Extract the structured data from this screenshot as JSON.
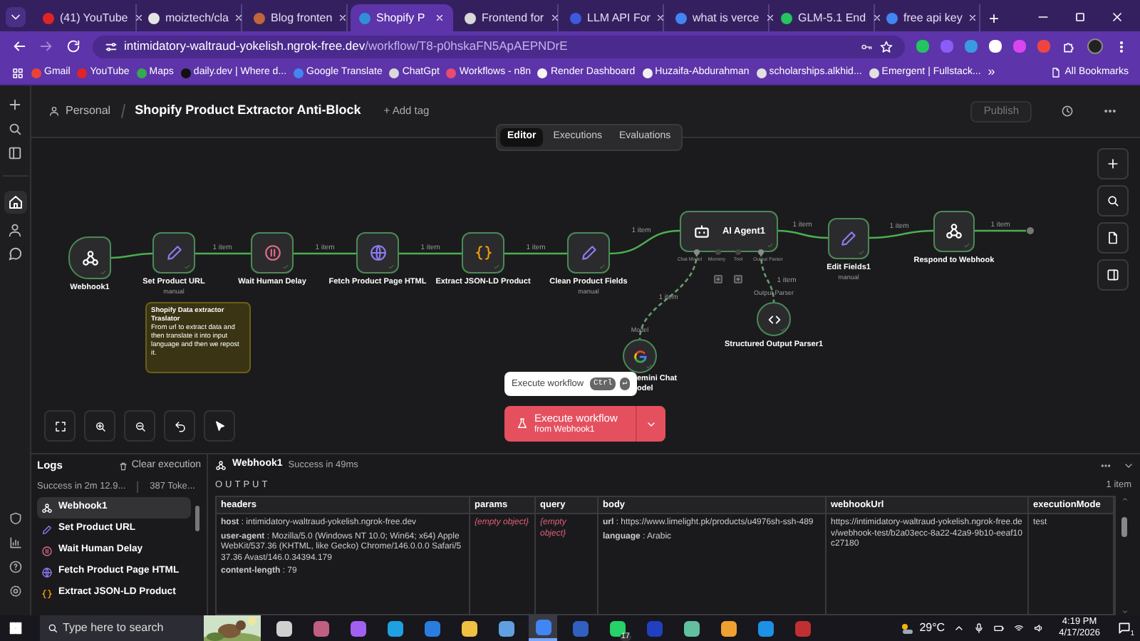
{
  "browser": {
    "tabs": [
      {
        "title": "(41) YouTube",
        "selected": false,
        "color": "#e02424"
      },
      {
        "title": "moiztech/cla",
        "selected": false,
        "color": "#e5e5e5"
      },
      {
        "title": "Blog fronten",
        "selected": false,
        "color": "#c0663a"
      },
      {
        "title": "Shopify P",
        "selected": true,
        "color": "#2f8fd8"
      },
      {
        "title": "Frontend for",
        "selected": false,
        "color": "#d9d9d9"
      },
      {
        "title": "LLM API For",
        "selected": false,
        "color": "#3b5bdb"
      },
      {
        "title": "what is verce",
        "selected": false,
        "color": "#4285f4"
      },
      {
        "title": "GLM-5.1 End",
        "selected": false,
        "color": "#22c55e"
      },
      {
        "title": "free api key",
        "selected": false,
        "color": "#4285f4"
      }
    ],
    "new_tab": "+",
    "url": {
      "host": "intimidatory-waltraud-yokelish.ngrok-free.dev",
      "path": "/workflow/T8-p0hskaFN5ApAEPNDrE"
    },
    "bookmarks": [
      {
        "label": "Gmail",
        "color": "#ea4335"
      },
      {
        "label": "YouTube",
        "color": "#e02424"
      },
      {
        "label": "Maps",
        "color": "#34a853"
      },
      {
        "label": "daily.dev | Where d...",
        "color": "#111111"
      },
      {
        "label": "Google Translate",
        "color": "#4285f4"
      },
      {
        "label": "ChatGpt",
        "color": "#d9d9d9"
      },
      {
        "label": "Workflows - n8n",
        "color": "#ea4b71"
      },
      {
        "label": "Render Dashboard",
        "color": "#f5f5f5"
      },
      {
        "label": "Huzaifa-Abdurahman",
        "color": "#f0f0f0"
      },
      {
        "label": "scholarships.alkhid...",
        "color": "#e0e0e0"
      },
      {
        "label": "Emergent | Fullstack...",
        "color": "#e0e0e0"
      }
    ],
    "more": "»",
    "all_bookmarks": "All Bookmarks"
  },
  "header": {
    "project": "Personal",
    "title": "Shopify Product Extractor Anti-Block",
    "add_tag": "+ Add tag",
    "publish": "Publish"
  },
  "view_tabs": [
    {
      "label": "Editor",
      "selected": true
    },
    {
      "label": "Executions",
      "selected": false
    },
    {
      "label": "Evaluations",
      "selected": false
    }
  ],
  "nodes": [
    {
      "kind": "webhook",
      "label": "Webhook1",
      "success": true
    },
    {
      "kind": "set",
      "label": "Set Product URL",
      "note": "manual",
      "success": true
    },
    {
      "kind": "wait",
      "label": "Wait Human Delay",
      "success": true
    },
    {
      "kind": "http",
      "label": "Fetch Product Page HTML",
      "success": true
    },
    {
      "kind": "code",
      "label": "Extract JSON-LD Product",
      "success": true
    },
    {
      "kind": "set",
      "label": "Clean Product Fields",
      "note": "manual",
      "success": true
    },
    {
      "kind": "agent",
      "label": "AI Agent1",
      "success": true,
      "ports": [
        {
          "label": "Chat Model",
          "connected": true
        },
        {
          "label": "Memory",
          "connected": false
        },
        {
          "label": "Tool",
          "connected": false
        },
        {
          "label": "Output Parser",
          "connected": true
        }
      ]
    },
    {
      "kind": "set",
      "label": "Edit Fields1",
      "note": "manual",
      "success": true
    },
    {
      "kind": "respond",
      "label": "Respond to Webhook",
      "success": true
    },
    {
      "kind": "model",
      "label": "emini Chat\nodel",
      "port_label": "Model",
      "success": true
    },
    {
      "kind": "parser",
      "label": "Structured Output Parser1",
      "port_label": "Output Parser",
      "success": true
    }
  ],
  "connections": [
    {
      "label": "1 item"
    },
    {
      "label": "1 item"
    },
    {
      "label": "1 item"
    },
    {
      "label": "1 item"
    },
    {
      "label": "1 item"
    },
    {
      "label": "1 item"
    },
    {
      "label": "1 item"
    },
    {
      "label": "1 item"
    },
    {
      "label": "1 item"
    },
    {
      "label": "1 item"
    }
  ],
  "sticky_note": {
    "title": "Shopify Data extractor\nTraslator",
    "body": "From url to extract data and then translate it into input language and then we repost it."
  },
  "execute": {
    "tooltip": "Execute workflow",
    "keys": [
      "Ctrl",
      "↵"
    ],
    "label": "Execute workflow",
    "sublabel": "from Webhook1"
  },
  "logs": {
    "title": "Logs",
    "clear": "Clear execution",
    "summary": "Success in 2m 12.9...",
    "tokens": "387 Toke...",
    "items": [
      {
        "kind": "webhook",
        "label": "Webhook1",
        "selected": true
      },
      {
        "kind": "set",
        "label": "Set Product URL",
        "selected": false
      },
      {
        "kind": "wait",
        "label": "Wait Human Delay",
        "selected": false
      },
      {
        "kind": "http",
        "label": "Fetch Product Page HTML",
        "selected": false
      },
      {
        "kind": "code",
        "label": "Extract JSON-LD Product",
        "selected": false
      }
    ]
  },
  "output": {
    "node": "Webhook1",
    "status": "Success in 49ms",
    "heading": "OUTPUT",
    "count": "1 item",
    "columns": [
      "headers",
      "params",
      "query",
      "body",
      "webhookUrl",
      "executionMode"
    ],
    "cells": [
      {
        "kind": "object",
        "entries": [
          "**host** : intimidatory-waltraud-yokelish.ngrok-free.dev",
          "**user-agent** : Mozilla/5.0 (Windows NT 10.0; Win64; x64) AppleWebKit/537.36 (KHTML, like Gecko) Chrome/146.0.0.0 Safari/537.36 Avast/146.0.34394.179",
          "**content-length** : 79"
        ]
      },
      {
        "kind": "empty",
        "text": "{empty object}"
      },
      {
        "kind": "empty",
        "text": "{empty object}"
      },
      {
        "kind": "object",
        "entries": [
          "**url** : https://www.limelight.pk/products/u4976sh-ssh-489",
          "**language** : Arabic"
        ]
      },
      {
        "kind": "text",
        "text": "https://intimidatory-waltraud-yokelish.ngrok-free.dev/webhook-test/b2a03ecc-8a22-42a9-9b10-eeaf10c27180"
      },
      {
        "kind": "text",
        "text": "test"
      }
    ]
  },
  "taskbar": {
    "search_placeholder": "Type here to search",
    "apps": [
      {
        "color": "#d0d0d0",
        "selected": false
      },
      {
        "color": "#c06080",
        "selected": false
      },
      {
        "color": "#a060f0",
        "selected": false
      },
      {
        "color": "#1fa0e0",
        "selected": false
      },
      {
        "color": "#2a7de0",
        "selected": false
      },
      {
        "color": "#f0c040",
        "selected": false
      },
      {
        "color": "#60a0e0",
        "selected": false
      },
      {
        "color": "#4285f4",
        "selected": true
      },
      {
        "color": "#3060c0",
        "selected": false
      },
      {
        "color": "#25d366",
        "selected": false,
        "badge": "17"
      },
      {
        "color": "#2040c0",
        "selected": false
      },
      {
        "color": "#60c0a0",
        "selected": false
      },
      {
        "color": "#f0a030",
        "selected": false
      },
      {
        "color": "#1d91e6",
        "selected": false
      },
      {
        "color": "#c03030",
        "selected": false
      }
    ],
    "weather": "29°C",
    "time": "4:19 PM",
    "date": "4/17/2026",
    "notifications": "1"
  }
}
